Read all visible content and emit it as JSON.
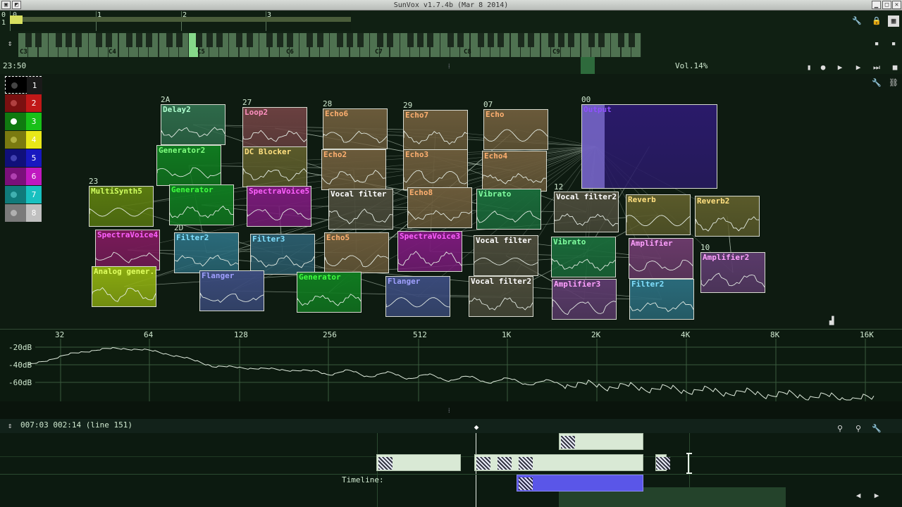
{
  "window": {
    "title": "SunVox v1.7.4b (Mar  8 2014)"
  },
  "pattern_ruler": {
    "marks": [
      "0",
      "1",
      "2",
      "3"
    ],
    "row_labels": [
      "0",
      "1"
    ]
  },
  "keyboard": {
    "octaves": [
      "C3",
      "C4",
      "C5",
      "C6",
      "C7",
      "C8",
      "C9"
    ]
  },
  "status": {
    "time": "23:50",
    "volume": "Vol.14%"
  },
  "palette": [
    {
      "num": "1",
      "color": "#000000",
      "dot": "#444444",
      "numcolor": "#ffffff",
      "bg": "#1a1a1a"
    },
    {
      "num": "2",
      "color": "#7a1010",
      "dot": "#b04040",
      "numcolor": "#ffffff",
      "bg": "#c01818"
    },
    {
      "num": "3",
      "color": "#107a10",
      "dot": "#ffffff",
      "numcolor": "#ffffff",
      "bg": "#18c018"
    },
    {
      "num": "4",
      "color": "#7a7a10",
      "dot": "#b0b040",
      "numcolor": "#ffffff",
      "bg": "#e8e818"
    },
    {
      "num": "5",
      "color": "#10107a",
      "dot": "#4040b0",
      "numcolor": "#ffffff",
      "bg": "#1818c0"
    },
    {
      "num": "6",
      "color": "#7a107a",
      "dot": "#b040b0",
      "numcolor": "#ffffff",
      "bg": "#c018c0"
    },
    {
      "num": "7",
      "color": "#107a7a",
      "dot": "#40b0b0",
      "numcolor": "#ffffff",
      "bg": "#18c0c0"
    },
    {
      "num": "8",
      "color": "#7a7a7a",
      "dot": "#b0b0b0",
      "numcolor": "#ffffff",
      "bg": "#c0c0c0"
    }
  ],
  "modules": [
    {
      "name": "Delay2",
      "num": "2A",
      "bg": "#2e6a4a",
      "fg": "#b0ffd0"
    },
    {
      "name": "Loop2",
      "num": "27",
      "bg": "#6a4040",
      "fg": "#ff90c0"
    },
    {
      "name": "Echo6",
      "num": "28",
      "bg": "#6a5a3a",
      "fg": "#ffb070"
    },
    {
      "name": "Echo7",
      "num": "29",
      "bg": "#6a5a3a",
      "fg": "#ffb070"
    },
    {
      "name": "Echo",
      "num": "07",
      "bg": "#6a5a3a",
      "fg": "#ffb070"
    },
    {
      "name": "Output",
      "num": "00",
      "bg": "#2a1a6a",
      "fg": "#9050ff"
    },
    {
      "name": "Generator2",
      "num": "",
      "bg": "#107a20",
      "fg": "#80ff80"
    },
    {
      "name": "DC Blocker",
      "num": "",
      "bg": "#5a5a2a",
      "fg": "#ffe080"
    },
    {
      "name": "Echo2",
      "num": "",
      "bg": "#6a5a3a",
      "fg": "#ffb070"
    },
    {
      "name": "Echo3",
      "num": "",
      "bg": "#6a5a3a",
      "fg": "#ffb070"
    },
    {
      "name": "Echo4",
      "num": "",
      "bg": "#6a5a3a",
      "fg": "#ffb070"
    },
    {
      "name": "MultiSynth5",
      "num": "23",
      "bg": "#5a7a10",
      "fg": "#d0ff60"
    },
    {
      "name": "Generator",
      "num": "",
      "bg": "#107a20",
      "fg": "#40ff40"
    },
    {
      "name": "SpectraVoice5",
      "num": "",
      "bg": "#7a1a7a",
      "fg": "#ff60ff"
    },
    {
      "name": "Vocal filter",
      "num": "",
      "bg": "#4a4a3a",
      "fg": "#ffffff"
    },
    {
      "name": "Echo8",
      "num": "",
      "bg": "#6a5a3a",
      "fg": "#ffb070"
    },
    {
      "name": "Vibrato",
      "num": "",
      "bg": "#1a6a3a",
      "fg": "#80ffa0"
    },
    {
      "name": "Vocal filter2",
      "num": "12",
      "bg": "#4a4a3a",
      "fg": "#ffffff"
    },
    {
      "name": "Reverb",
      "num": "",
      "bg": "#5a5a2a",
      "fg": "#ffe080"
    },
    {
      "name": "Reverb2",
      "num": "",
      "bg": "#5a5a2a",
      "fg": "#ffe080"
    },
    {
      "name": "SpectraVoice4",
      "num": "",
      "bg": "#7a1a5a",
      "fg": "#ff60ff"
    },
    {
      "name": "Filter2",
      "num": "2D",
      "bg": "#2a6a7a",
      "fg": "#80e0ff"
    },
    {
      "name": "Filter3",
      "num": "",
      "bg": "#2a5a6a",
      "fg": "#80e0ff"
    },
    {
      "name": "Echo5",
      "num": "",
      "bg": "#6a5a3a",
      "fg": "#ffb070"
    },
    {
      "name": "SpectraVoice3",
      "num": "",
      "bg": "#7a1a7a",
      "fg": "#ff60ff"
    },
    {
      "name": "Vocal filter",
      "num": "",
      "bg": "#4a4a3a",
      "fg": "#ffffff"
    },
    {
      "name": "Vibrato",
      "num": "",
      "bg": "#1a6a3a",
      "fg": "#80ffa0"
    },
    {
      "name": "Amplifier",
      "num": "",
      "bg": "#6a3a6a",
      "fg": "#ffa0ff"
    },
    {
      "name": "Amplifier2",
      "num": "10",
      "bg": "#5a3a6a",
      "fg": "#ffa0ff"
    },
    {
      "name": "Analog gener.r",
      "num": "",
      "bg": "#8aaa10",
      "fg": "#e0ff60"
    },
    {
      "name": "Flanger",
      "num": "",
      "bg": "#3a4a7a",
      "fg": "#a0a0ff"
    },
    {
      "name": "Generator",
      "num": "",
      "bg": "#107a20",
      "fg": "#40ff40"
    },
    {
      "name": "Flanger",
      "num": "",
      "bg": "#3a4a7a",
      "fg": "#a0a0ff"
    },
    {
      "name": "Vocal filter2",
      "num": "",
      "bg": "#4a4a3a",
      "fg": "#ffffff"
    },
    {
      "name": "Amplifier3",
      "num": "",
      "bg": "#5a3a6a",
      "fg": "#ffa0ff"
    },
    {
      "name": "Filter2",
      "num": "",
      "bg": "#2a6a7a",
      "fg": "#80e0ff"
    }
  ],
  "spectrum": {
    "freq_labels": [
      "32",
      "64",
      "128",
      "256",
      "512",
      "1K",
      "2K",
      "4K",
      "8K",
      "16K"
    ],
    "db_labels": [
      "-20dB",
      "-40dB",
      "-60dB"
    ]
  },
  "timeline": {
    "position": "007:03  002:14  (line 151)",
    "label": "Timeline:"
  }
}
